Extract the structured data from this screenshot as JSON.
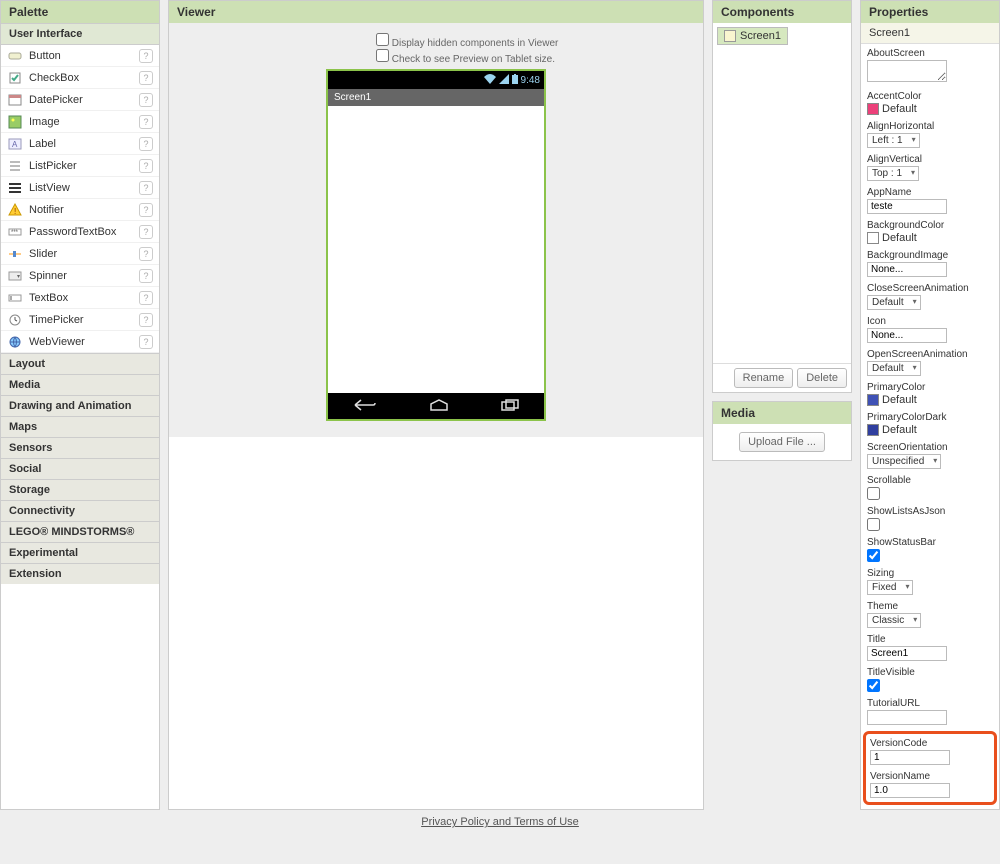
{
  "palette": {
    "title": "Palette",
    "ui_header": "User Interface",
    "items": [
      {
        "label": "Button"
      },
      {
        "label": "CheckBox"
      },
      {
        "label": "DatePicker"
      },
      {
        "label": "Image"
      },
      {
        "label": "Label"
      },
      {
        "label": "ListPicker"
      },
      {
        "label": "ListView"
      },
      {
        "label": "Notifier"
      },
      {
        "label": "PasswordTextBox"
      },
      {
        "label": "Slider"
      },
      {
        "label": "Spinner"
      },
      {
        "label": "TextBox"
      },
      {
        "label": "TimePicker"
      },
      {
        "label": "WebViewer"
      }
    ],
    "categories": [
      "Layout",
      "Media",
      "Drawing and Animation",
      "Maps",
      "Sensors",
      "Social",
      "Storage",
      "Connectivity",
      "LEGO® MINDSTORMS®",
      "Experimental",
      "Extension"
    ]
  },
  "viewer": {
    "title": "Viewer",
    "opt1": "Display hidden components in Viewer",
    "opt2": "Check to see Preview on Tablet size.",
    "clock": "9:48",
    "screen_title": "Screen1"
  },
  "components": {
    "title": "Components",
    "item": "Screen1",
    "rename": "Rename",
    "delete": "Delete"
  },
  "media": {
    "title": "Media",
    "upload": "Upload File ..."
  },
  "properties": {
    "title": "Properties",
    "name": "Screen1",
    "about_label": "AboutScreen",
    "about_value": "",
    "accent_label": "AccentColor",
    "accent_value": "Default",
    "accent_color": "#ec407a",
    "alignH_label": "AlignHorizontal",
    "alignH_value": "Left : 1",
    "alignV_label": "AlignVertical",
    "alignV_value": "Top : 1",
    "appname_label": "AppName",
    "appname_value": "teste",
    "bgcolor_label": "BackgroundColor",
    "bgcolor_value": "Default",
    "bgcolor_color": "#ffffff",
    "bgimg_label": "BackgroundImage",
    "bgimg_value": "None...",
    "closeanim_label": "CloseScreenAnimation",
    "closeanim_value": "Default",
    "icon_label": "Icon",
    "icon_value": "None...",
    "openanim_label": "OpenScreenAnimation",
    "openanim_value": "Default",
    "primary_label": "PrimaryColor",
    "primary_value": "Default",
    "primary_color": "#3f51b5",
    "primarydark_label": "PrimaryColorDark",
    "primarydark_value": "Default",
    "primarydark_color": "#303f9f",
    "orient_label": "ScreenOrientation",
    "orient_value": "Unspecified",
    "scrollable_label": "Scrollable",
    "showlists_label": "ShowListsAsJson",
    "showstatus_label": "ShowStatusBar",
    "sizing_label": "Sizing",
    "sizing_value": "Fixed",
    "theme_label": "Theme",
    "theme_value": "Classic",
    "title_label": "Title",
    "title_value": "Screen1",
    "titlevis_label": "TitleVisible",
    "tuturl_label": "TutorialURL",
    "tuturl_value": "",
    "vercode_label": "VersionCode",
    "vercode_value": "1",
    "vername_label": "VersionName",
    "vername_value": "1.0"
  },
  "footer_link": "Privacy Policy and Terms of Use"
}
